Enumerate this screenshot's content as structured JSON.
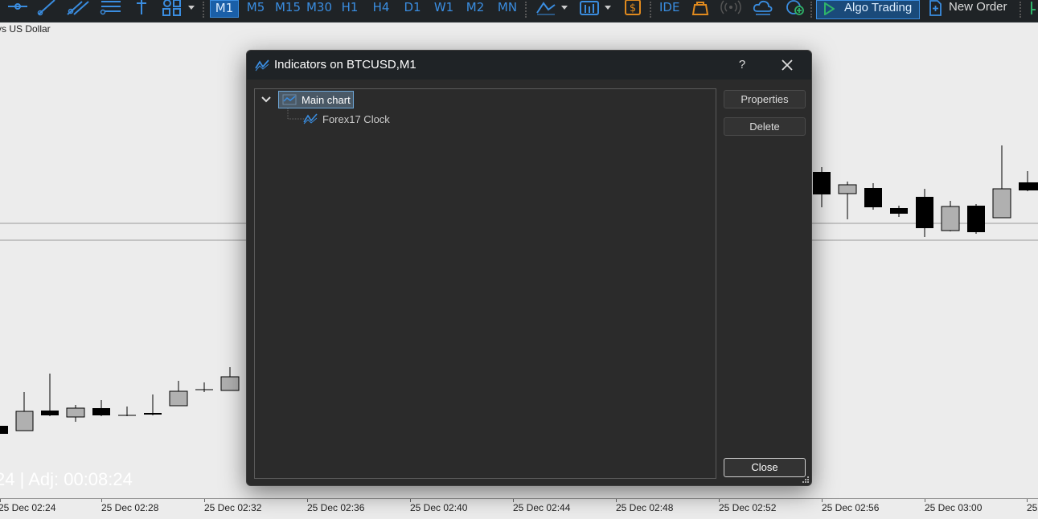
{
  "toolbar": {
    "timeframes": [
      "M1",
      "M5",
      "M15",
      "M30",
      "H1",
      "H4",
      "D1",
      "W1",
      "M2",
      "MN"
    ],
    "active_timeframe": "M1",
    "ide_label": "IDE",
    "algo_trading_label": "Algo Trading",
    "new_order_label": "New Order",
    "icons": [
      "crosshair-icon",
      "trendline-icon",
      "channel-icon",
      "fibonacci-icon",
      "vertical-line-icon",
      "shapes-icon",
      "dropdown-icon",
      "indicators-icon",
      "chart-type-icon",
      "dollar-icon",
      "market-bag-icon",
      "signals-icon",
      "cloud-icon",
      "add-indicator-icon",
      "play-icon",
      "new-order-icon"
    ]
  },
  "chart": {
    "symbol_label": "ys US Dollar",
    "clock_text": "24 | Adj: 00:08:24",
    "x_labels": [
      "25 Dec 02:24",
      "25 Dec 02:28",
      "25 Dec 02:32",
      "25 Dec 02:36",
      "25 Dec 02:40",
      "25 Dec 02:44",
      "25 Dec 02:48",
      "25 Dec 02:52",
      "25 Dec 02:56",
      "25 Dec 03:00",
      "25"
    ]
  },
  "dialog": {
    "title": "Indicators on BTCUSD,M1",
    "help_label": "?",
    "tree": {
      "root_label": "Main chart",
      "children": [
        "Forex17 Clock"
      ]
    },
    "buttons": {
      "properties": "Properties",
      "delete": "Delete",
      "close": "Close"
    }
  },
  "colors": {
    "toolbar_bg": "#1f2326",
    "accent_blue": "#3a8de0",
    "dialog_bg": "#2b2b2b",
    "chart_bg": "#ececec",
    "dollar_orange": "#e08a1e"
  }
}
